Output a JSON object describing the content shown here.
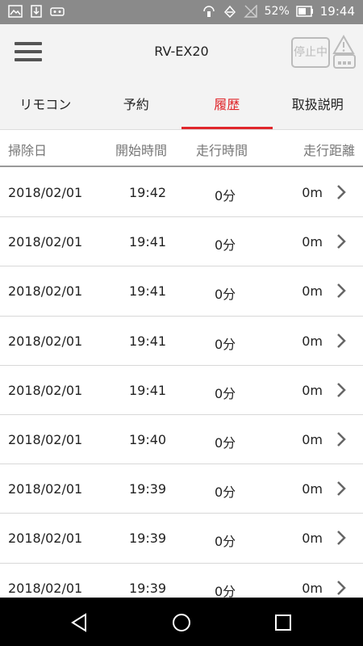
{
  "status_bar": {
    "battery": "52%",
    "time": "19:44"
  },
  "header": {
    "title": "RV-EX20",
    "stop_label": "停止中"
  },
  "tabs": [
    {
      "label": "リモコン"
    },
    {
      "label": "予約"
    },
    {
      "label": "履歴",
      "active": true
    },
    {
      "label": "取扱説明"
    }
  ],
  "columns": {
    "date": "掃除日",
    "start": "開始時間",
    "duration": "走行時間",
    "distance": "走行距離"
  },
  "rows": [
    {
      "date": "2018/02/01",
      "start": "19:42",
      "duration": "0分",
      "distance": "0m"
    },
    {
      "date": "2018/02/01",
      "start": "19:41",
      "duration": "0分",
      "distance": "0m"
    },
    {
      "date": "2018/02/01",
      "start": "19:41",
      "duration": "0分",
      "distance": "0m"
    },
    {
      "date": "2018/02/01",
      "start": "19:41",
      "duration": "0分",
      "distance": "0m"
    },
    {
      "date": "2018/02/01",
      "start": "19:41",
      "duration": "0分",
      "distance": "0m"
    },
    {
      "date": "2018/02/01",
      "start": "19:40",
      "duration": "0分",
      "distance": "0m"
    },
    {
      "date": "2018/02/01",
      "start": "19:39",
      "duration": "0分",
      "distance": "0m"
    },
    {
      "date": "2018/02/01",
      "start": "19:39",
      "duration": "0分",
      "distance": "0m"
    },
    {
      "date": "2018/02/01",
      "start": "19:39",
      "duration": "0分",
      "distance": "0m"
    }
  ],
  "colors": {
    "accent": "#e0262b",
    "status_bar": "#8a8a8a",
    "header_bg": "#f3f3f3"
  },
  "icons": {
    "status_left": [
      "image-icon",
      "download-icon",
      "game-icon"
    ],
    "status_right": [
      "nfc-icon",
      "wifi-off-icon",
      "signal-off-icon",
      "battery-icon"
    ],
    "header": [
      "menu-icon",
      "warning-icon"
    ],
    "nav": [
      "back-icon",
      "home-icon",
      "recents-icon"
    ]
  }
}
